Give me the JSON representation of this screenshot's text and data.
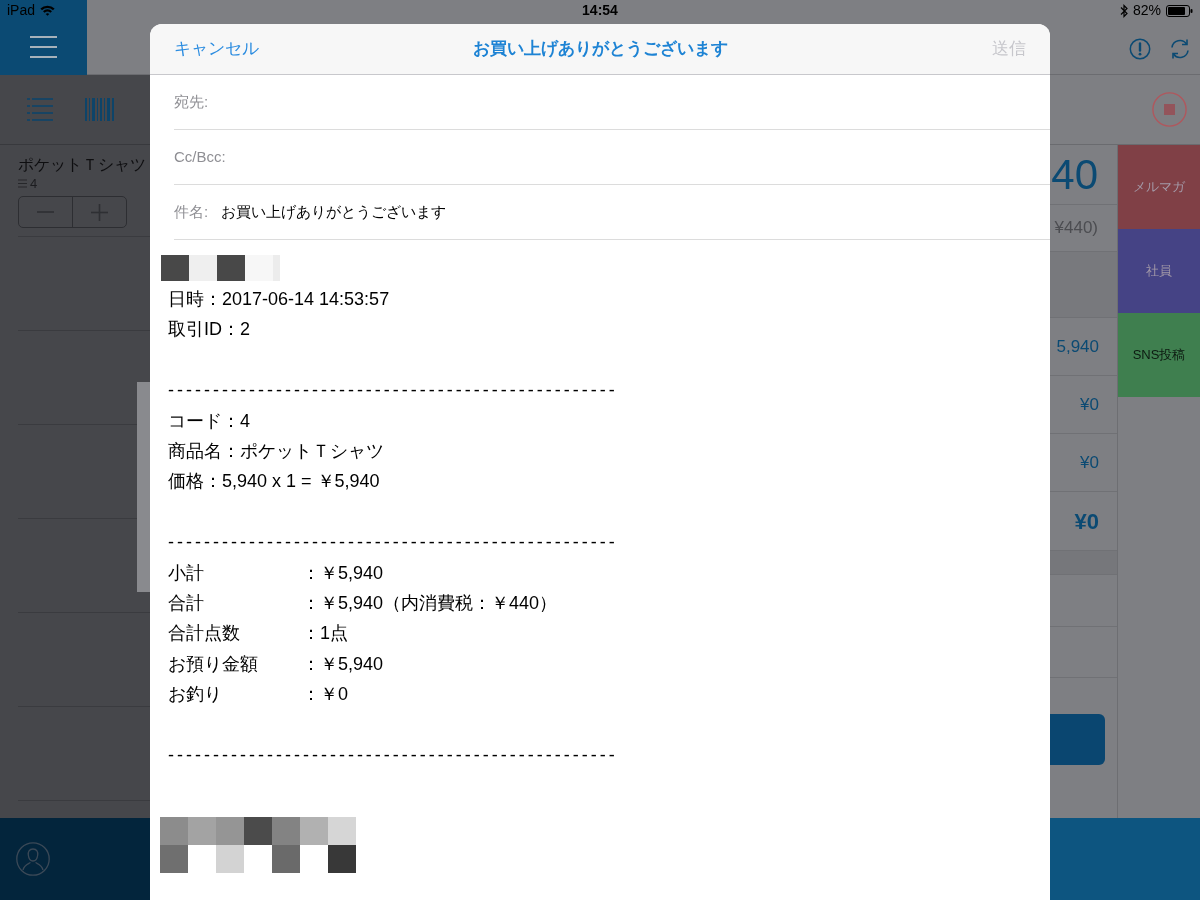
{
  "status_bar": {
    "device": "iPad",
    "time": "14:54",
    "battery": "82%"
  },
  "product_list": {
    "items": [
      {
        "name": "ポケットＴシャツ",
        "code": "4"
      }
    ]
  },
  "totals": {
    "total": "40",
    "tax": "¥440)",
    "amounts": [
      "5,940",
      "¥0",
      "¥0"
    ],
    "change": "¥0"
  },
  "tags": [
    {
      "label": "メルマガ",
      "color": "#804046"
    },
    {
      "label": "社員",
      "color": "#454385"
    },
    {
      "label": "SNS投稿",
      "color": "#3f7f4f"
    }
  ],
  "mail_compose": {
    "cancel": "キャンセル",
    "title": "お買い上げありがとうございます",
    "send": {
      "label": "送信",
      "disabled": true
    },
    "fields": [
      {
        "label": "宛先:"
      },
      {
        "label": "Cc/Bcc:"
      },
      {
        "label": "件名:",
        "value": "お買い上げありがとうございます"
      }
    ],
    "body": [
      {
        "kind": "header_image"
      },
      {
        "kind": "line",
        "text": "日時：2017-06-14 14:53:57"
      },
      {
        "kind": "line",
        "text": "取引ID：2"
      },
      {
        "kind": "blank"
      },
      {
        "kind": "rule",
        "text": "--------------------------------------------------"
      },
      {
        "kind": "line",
        "text": "コード：4"
      },
      {
        "kind": "line",
        "text": "商品名：ポケットＴシャツ"
      },
      {
        "kind": "line",
        "text": "価格：5,940 x 1 = ￥5,940"
      },
      {
        "kind": "blank"
      },
      {
        "kind": "rule",
        "text": "--------------------------------------------------"
      },
      {
        "kind": "pair",
        "label": "小計",
        "value": "：￥5,940"
      },
      {
        "kind": "pair",
        "label": "合計",
        "value": "：￥5,940（内消費税：￥440）"
      },
      {
        "kind": "pair",
        "label": "合計点数",
        "value": "：1点"
      },
      {
        "kind": "pair",
        "label": "お預り金額",
        "value": "：￥5,940"
      },
      {
        "kind": "pair",
        "label": "お釣り",
        "value": "：￥0"
      },
      {
        "kind": "blank"
      },
      {
        "kind": "rule",
        "text": "--------------------------------------------------"
      },
      {
        "kind": "blank"
      },
      {
        "kind": "footer_image"
      }
    ]
  }
}
